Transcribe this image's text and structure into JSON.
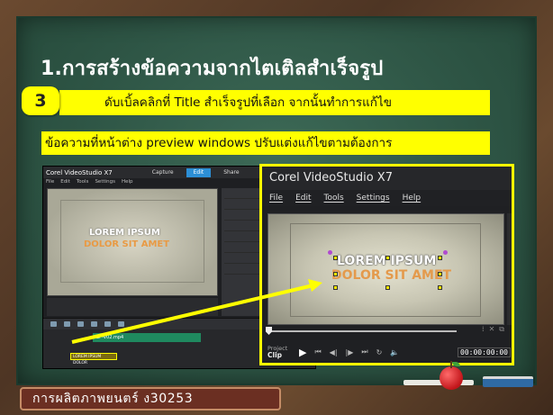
{
  "slide": {
    "title": "1.การสร้างข้อความจากไตเติลสำเร็จรูป",
    "step_number": "3",
    "instruction_line1": "ดับเบิ้ลคลิกที่ Title สำเร็จรูปที่เลือก จากนั้นทำการแก้ไข",
    "instruction_line2": "ข้อความที่หน้าต่าง preview windows ปรับแต่งแก้ไขตามต้องการ",
    "footer": "การผลิตภาพยนตร์ ง30253"
  },
  "small_screenshot": {
    "app_title": "Corel VideoStudio X7",
    "tabs": [
      "Capture",
      "Edit",
      "Share"
    ],
    "menu": [
      "File",
      "Edit",
      "Tools",
      "Settings",
      "Help"
    ],
    "preview_line1": "LOREM IPSUM",
    "preview_line2": "DOLOR SIT AMET",
    "clip_label": "SP-V02.mp4",
    "title_clip_label": "LOREM IPSUM DOLOR"
  },
  "big_screenshot": {
    "app_title": "Corel VideoStudio X7",
    "menu": [
      "File",
      "Edit",
      "Tools",
      "Settings",
      "Help"
    ],
    "preview_line1": "LOREM IPSUM",
    "preview_line2": "DOLOR SIT AMET",
    "project_label": "Project",
    "clip_label": "Clip",
    "timecode": "00:00:00:00"
  },
  "colors": {
    "highlight": "#ffff00",
    "board": "#2e5545",
    "title_orange": "#e49a4c",
    "footer_bg": "#6b2f22"
  }
}
